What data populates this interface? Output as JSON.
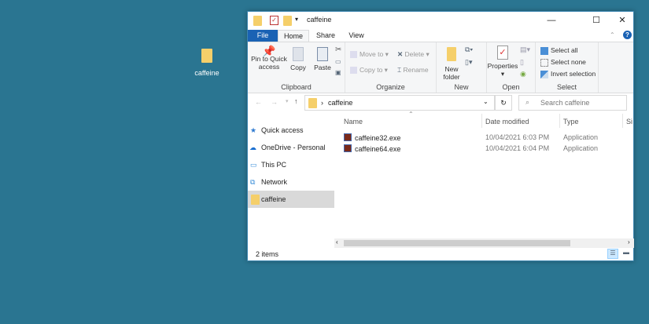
{
  "desktop": {
    "icon_label": "caffeine"
  },
  "window": {
    "title": "caffeine",
    "controls": {
      "minimize": "—",
      "maximize": "☐",
      "close": "✕"
    }
  },
  "tabs": [
    "File",
    "Home",
    "Share",
    "View"
  ],
  "ribbon": {
    "clipboard": {
      "pin": "Pin to Quick access",
      "copy": "Copy",
      "paste": "Paste",
      "label": "Clipboard"
    },
    "organize": {
      "move_to": "Move to",
      "copy_to": "Copy to",
      "delete": "Delete",
      "rename": "Rename",
      "label": "Organize"
    },
    "new": {
      "new_folder": "New folder",
      "label": "New"
    },
    "open": {
      "properties": "Properties",
      "label": "Open"
    },
    "select": {
      "select_all": "Select all",
      "select_none": "Select none",
      "invert": "Invert selection",
      "label": "Select"
    }
  },
  "address": {
    "path": "caffeine",
    "search_placeholder": "Search caffeine"
  },
  "nav": [
    "Quick access",
    "OneDrive - Personal",
    "This PC",
    "Network",
    "caffeine"
  ],
  "columns": [
    "Name",
    "Date modified",
    "Type",
    "Si"
  ],
  "files": [
    {
      "name": "caffeine32.exe",
      "date": "10/04/2021 6:03 PM",
      "type": "Application"
    },
    {
      "name": "caffeine64.exe",
      "date": "10/04/2021 6:04 PM",
      "type": "Application"
    }
  ],
  "status": {
    "count": "2 items"
  }
}
